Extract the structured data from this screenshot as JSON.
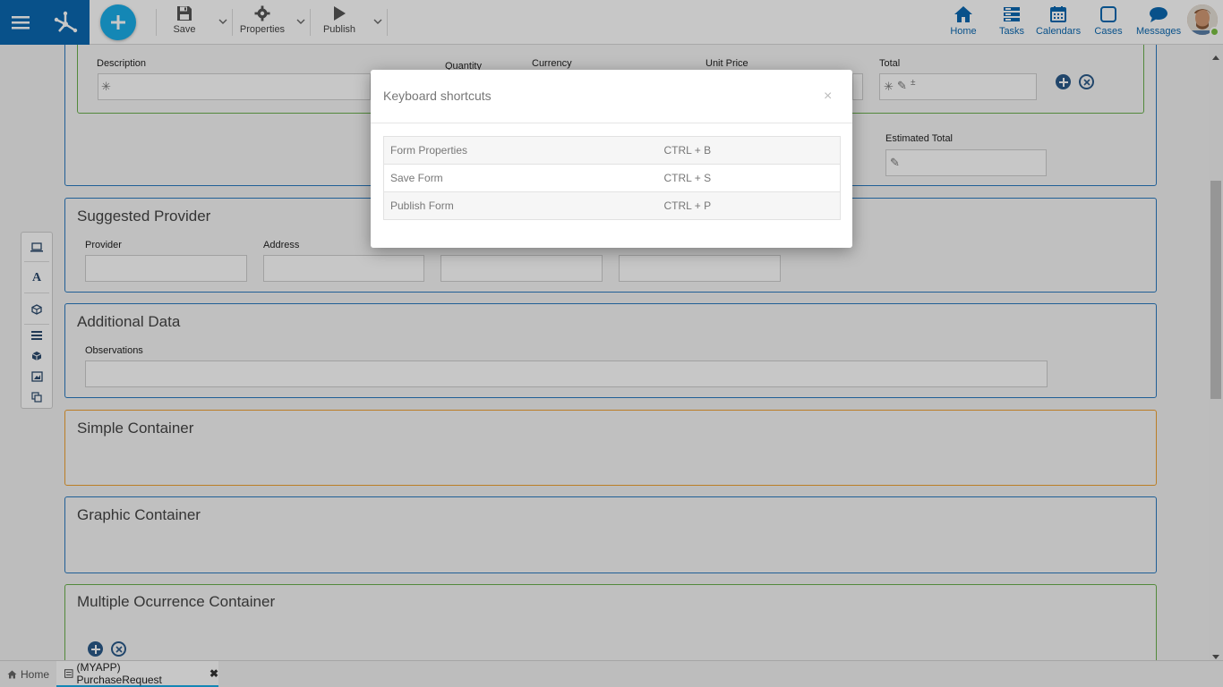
{
  "toolbar": {
    "save_label": "Save",
    "properties_label": "Properties",
    "publish_label": "Publish"
  },
  "nav": {
    "home": "Home",
    "tasks": "Tasks",
    "calendars": "Calendars",
    "cases": "Cases",
    "messages": "Messages"
  },
  "form": {
    "items": {
      "description": "Description",
      "quantity": "Quantity",
      "currency": "Currency",
      "unit_price": "Unit Price",
      "total": "Total"
    },
    "estimated_total": "Estimated Total",
    "suggested_provider": {
      "title": "Suggested Provider",
      "provider": "Provider",
      "address": "Address"
    },
    "additional_data": {
      "title": "Additional Data",
      "observations": "Observations"
    },
    "simple_container": "Simple Container",
    "graphic_container": "Graphic Container",
    "multiple_container": "Multiple Ocurrence Container"
  },
  "bottom_tabs": {
    "home": "Home",
    "current": "(MYAPP) PurchaseRequest"
  },
  "modal": {
    "title": "Keyboard shortcuts",
    "close": "×",
    "shortcuts": [
      {
        "name": "Form Properties",
        "key": "CTRL + B"
      },
      {
        "name": "Save Form",
        "key": "CTRL + S"
      },
      {
        "name": "Publish Form",
        "key": "CTRL + P"
      }
    ]
  },
  "colors": {
    "brand_blue": "#0b68b1",
    "accent_cyan": "#1aaee8",
    "container_blue": "#2a7ac0",
    "container_orange": "#f0a030",
    "container_green": "#6ab04c"
  }
}
